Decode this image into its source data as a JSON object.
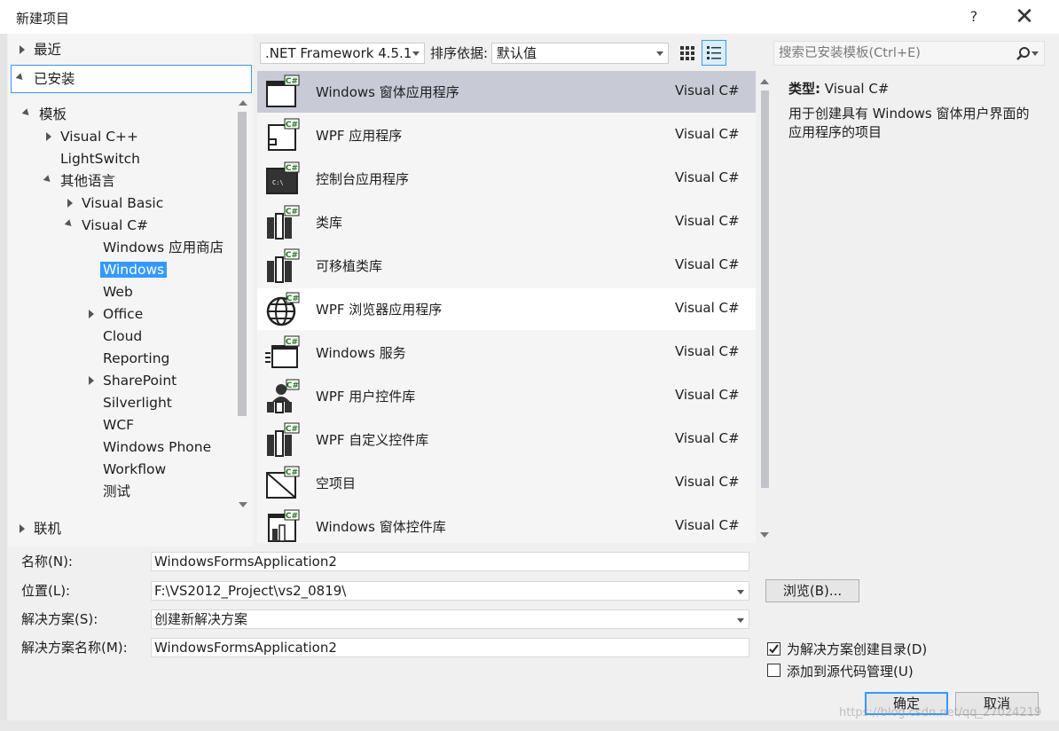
{
  "window": {
    "title": "新建项目",
    "help": "?",
    "close": "✕"
  },
  "tree": {
    "recent": "最近",
    "installed": "已安装",
    "templates": "模板",
    "vcpp": "Visual C++",
    "lightswitch": "LightSwitch",
    "other_langs": "其他语言",
    "vb": "Visual Basic",
    "vcs": "Visual C#",
    "windows_store": "Windows 应用商店",
    "windows": "Windows",
    "web": "Web",
    "office": "Office",
    "cloud": "Cloud",
    "reporting": "Reporting",
    "sharepoint": "SharePoint",
    "silverlight": "Silverlight",
    "wcf": "WCF",
    "windows_phone": "Windows Phone",
    "workflow": "Workflow",
    "test": "测试",
    "online": "联机"
  },
  "toolbar": {
    "framework": ".NET Framework 4.5.1",
    "sort_label": "排序依据:",
    "sort_value": "默认值",
    "search_placeholder": "搜索已安装模板(Ctrl+E)"
  },
  "templates": [
    {
      "name": "Windows 窗体应用程序",
      "lang": "Visual C#"
    },
    {
      "name": "WPF 应用程序",
      "lang": "Visual C#"
    },
    {
      "name": "控制台应用程序",
      "lang": "Visual C#"
    },
    {
      "name": "类库",
      "lang": "Visual C#"
    },
    {
      "name": "可移植类库",
      "lang": "Visual C#"
    },
    {
      "name": "WPF 浏览器应用程序",
      "lang": "Visual C#"
    },
    {
      "name": "Windows 服务",
      "lang": "Visual C#"
    },
    {
      "name": "WPF 用户控件库",
      "lang": "Visual C#"
    },
    {
      "name": "WPF 自定义控件库",
      "lang": "Visual C#"
    },
    {
      "name": "空项目",
      "lang": "Visual C#"
    },
    {
      "name": "Windows 窗体控件库",
      "lang": "Visual C#"
    }
  ],
  "icon_badge": "C#",
  "console_glyph": "C:\\",
  "description": {
    "type_label": "类型:",
    "type_value": "Visual C#",
    "text": "用于创建具有 Windows 窗体用户界面的应用程序的项目"
  },
  "form": {
    "name_label": "名称(N):",
    "name_value": "WindowsFormsApplication2",
    "location_label": "位置(L):",
    "location_value": "F:\\VS2012_Project\\vs2_0819\\",
    "browse": "浏览(B)...",
    "solution_label": "解决方案(S):",
    "solution_value": "创建新解决方案",
    "solution_name_label": "解决方案名称(M):",
    "solution_name_value": "WindowsFormsApplication2",
    "create_dir": "为解决方案创建目录(D)",
    "create_dir_checked": true,
    "add_scc": "添加到源代码管理(U)",
    "add_scc_checked": false,
    "ok": "确定",
    "cancel": "取消"
  },
  "watermark": "https://blog.csdn.net/qq_27024219"
}
